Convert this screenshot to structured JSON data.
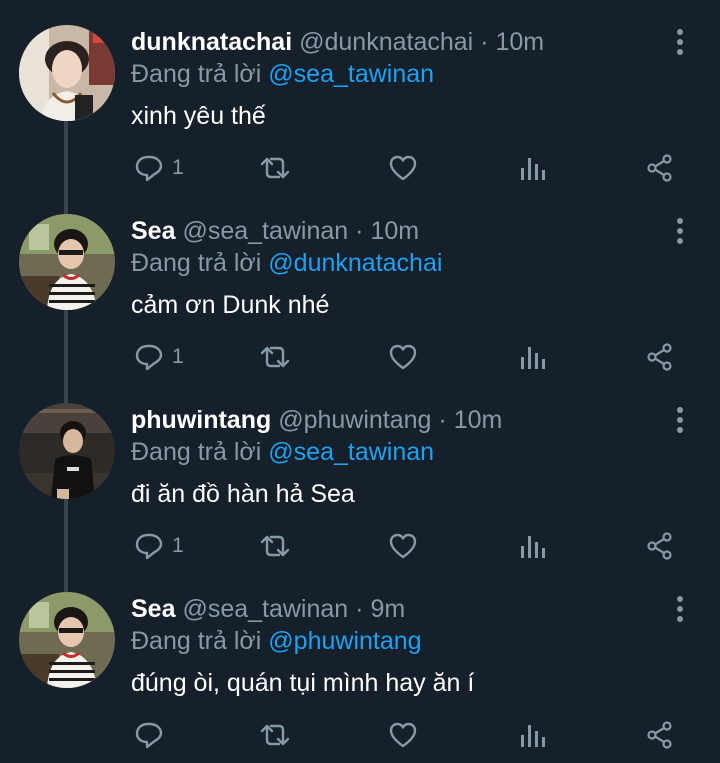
{
  "colors": {
    "background": "#15202b",
    "name": "#ffffff",
    "secondary": "#8899a6",
    "mention": "#1da1f2",
    "thread_line": "#38444d"
  },
  "tweets": [
    {
      "name": "dunknatachai",
      "handle": "@dunknatachai",
      "dot": "·",
      "time": "10m",
      "replying_prefix": "Đang trả lời",
      "replying_to": "@sea_tawinan",
      "text": "xinh yêu thế",
      "reply_count": "1"
    },
    {
      "name": "Sea",
      "handle": "@sea_tawinan",
      "dot": "·",
      "time": "10m",
      "replying_prefix": "Đang trả lời",
      "replying_to": "@dunknatachai",
      "text": "cảm ơn Dunk nhé",
      "reply_count": "1"
    },
    {
      "name": "phuwintang",
      "handle": "@phuwintang",
      "dot": "·",
      "time": "10m",
      "replying_prefix": "Đang trả lời",
      "replying_to": "@sea_tawinan",
      "text": "đi ăn đồ hàn hả Sea",
      "reply_count": "1"
    },
    {
      "name": "Sea",
      "handle": "@sea_tawinan",
      "dot": "·",
      "time": "9m",
      "replying_prefix": "Đang trả lời",
      "replying_to": "@phuwintang",
      "text": "đúng òi, quán tụi mình hay ăn í",
      "reply_count": ""
    }
  ]
}
